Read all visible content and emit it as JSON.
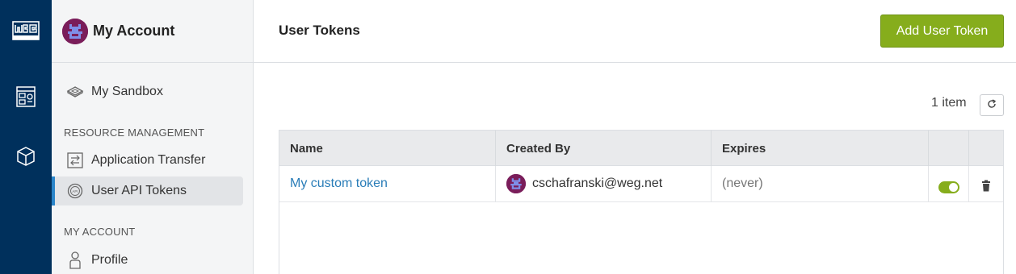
{
  "rail": {
    "logo_icon": "weg-logo-icon",
    "items": [
      {
        "icon": "dashboard-icon"
      },
      {
        "icon": "package-icon"
      }
    ]
  },
  "sidebar": {
    "title": "My Account",
    "avatar_icon": "user-avatar-icon",
    "sandbox": {
      "label": "My Sandbox",
      "icon": "sandbox-icon"
    },
    "resource_section": "RESOURCE MANAGEMENT",
    "resource_items": [
      {
        "label": "Application Transfer",
        "icon": "transfer-icon"
      },
      {
        "label": "User API Tokens",
        "icon": "api-icon",
        "active": true
      }
    ],
    "account_section": "MY ACCOUNT",
    "account_items": [
      {
        "label": "Profile",
        "icon": "profile-icon"
      }
    ]
  },
  "main": {
    "title": "User Tokens",
    "add_button": "Add User Token",
    "count": "1 item",
    "table": {
      "headers": [
        "Name",
        "Created By",
        "Expires",
        "",
        ""
      ],
      "rows": [
        {
          "name": "My custom token",
          "created_by": "cschafranski@weg.net",
          "expires": "(never)",
          "enabled": true
        }
      ]
    }
  },
  "colors": {
    "rail": "#00305c",
    "accent_green": "#86ad1c",
    "link": "#2a7db8",
    "active_border": "#2a85c9"
  }
}
